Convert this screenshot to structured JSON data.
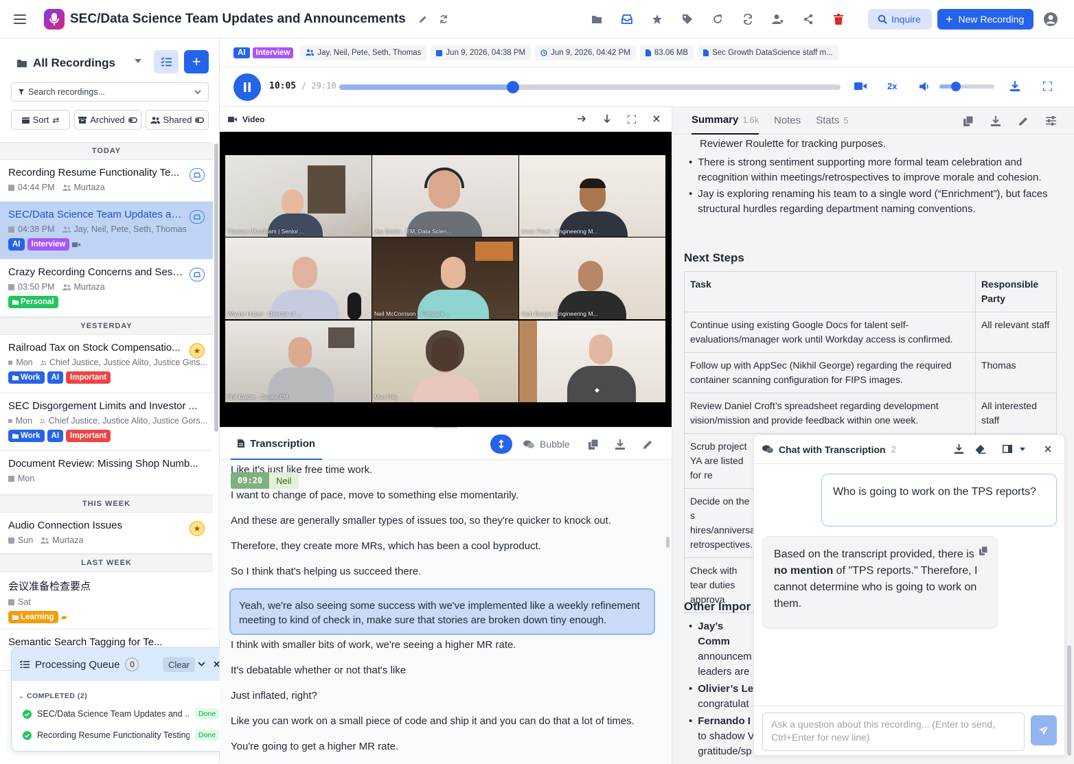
{
  "header": {
    "title": "SEC/Data Science Team Updates and Announcements",
    "inquire_label": "Inquire",
    "new_recording_label": "New Recording"
  },
  "sidebar": {
    "title": "All Recordings",
    "search_placeholder": "Search recordings...",
    "sort_label": "Sort",
    "archived_label": "Archived",
    "shared_label": "Shared",
    "sections": {
      "today": "TODAY",
      "yesterday": "YESTERDAY",
      "this_week": "THIS WEEK",
      "last_week": "LAST WEEK"
    },
    "recordings": [
      {
        "title": "Recording Resume Functionality Te...",
        "time": "04:44 PM",
        "people": "Murtaza"
      },
      {
        "title": "SEC/Data Science Team Updates an...",
        "time": "04:38 PM",
        "people": "Jay, Neil, Pete, Seth, Thomas",
        "tags": [
          "AI",
          "Interview"
        ]
      },
      {
        "title": "Crazy Recording Concerns and Sess...",
        "time": "03:50 PM",
        "people": "Murtaza",
        "tags": [
          "Personal"
        ]
      },
      {
        "title": "Railroad Tax on Stock Compensatio...",
        "time": "Mon",
        "people": "Chief Justice, Justice Alito, Justice Gins...",
        "tags": [
          "Work",
          "AI",
          "Important"
        ]
      },
      {
        "title": "SEC Disgorgement Limits and Investor ...",
        "time": "Mon",
        "people": "Chief Justice, Justice Alito, Justice Gors...",
        "tags": [
          "Work",
          "AI",
          "Important"
        ]
      },
      {
        "title": "Document Review: Missing Shop Numb...",
        "time": "Mon"
      },
      {
        "title": "Audio Connection Issues",
        "time": "Sun",
        "people": "Murtaza"
      },
      {
        "title": "会议准备检查要点",
        "time": "Sat",
        "tags": [
          "Learning"
        ]
      },
      {
        "title": "Semantic Search Tagging for Te..."
      }
    ]
  },
  "queue": {
    "title": "Processing Queue",
    "count": "0",
    "clear_label": "Clear",
    "completed_label": "COMPLETED (2)",
    "items": [
      {
        "name": "SEC/Data Science Team Updates and ...",
        "status": "Done"
      },
      {
        "name": "Recording Resume Functionality Testing",
        "status": "Done"
      }
    ]
  },
  "meta": {
    "ai": "AI",
    "interview": "Interview",
    "participants": "Jay, Neil, Pete, Seth, Thomas",
    "created": "Jun 9, 2026, 04:38 PM",
    "modified": "Jun 9, 2026, 04:42 PM",
    "size": "83.06 MB",
    "file": "Sec Growth DataScience staff m..."
  },
  "player": {
    "current": "10:05",
    "total": "/ 29:10",
    "speed": "2x",
    "progress": 0.347,
    "volume": 0.3
  },
  "video": {
    "label": "Video",
    "tiles": [
      {
        "name": "Thomas Woodham | Senior ..."
      },
      {
        "name": "Jay Swain - EM, Data Scien..."
      },
      {
        "name": "Amar Patel - Engineering M..."
      },
      {
        "name": "Wayne Haber - Director of ..."
      },
      {
        "name": "Neil McCorrison - Fullstack ..."
      },
      {
        "name": "Seth Berger, Engineering M..."
      },
      {
        "name": "Phil Calder - Senior EM"
      },
      {
        "name": "Mon Ray"
      },
      {
        "name": ""
      }
    ]
  },
  "transcription": {
    "tab_label": "Transcription",
    "bubble_label": "Bubble",
    "speaker_time": "09:20",
    "speaker_name": "Neil",
    "lines": [
      "Like it's just like free time work.",
      "I want to change of pace, move to something else momentarily.",
      "And these are generally smaller types of issues too, so they're quicker to knock out.",
      "Therefore, they create more MRs, which has been a cool byproduct.",
      "So I think that's helping us succeed there.",
      "Yeah, we're also seeing some success with we've implemented like a weekly refinement",
      "meeting to kind of check in, make sure that stories are broken down tiny enough.",
      "I think with smaller bits of work, we're seeing a higher MR rate.",
      "It's debatable whether or not that's like",
      "Just inflated, right?",
      "Like you can work on a small piece of code and ship it and you can do that a lot of times.",
      "You're going to get a higher MR rate."
    ]
  },
  "summary": {
    "tabs": [
      {
        "label": "Summary",
        "count": "1.6k"
      },
      {
        "label": "Notes",
        "count": ""
      },
      {
        "label": "Stats",
        "count": "5"
      }
    ],
    "line0": "Reviewer Roulette for tracking purposes.",
    "bullet1a": "There is strong sentiment supporting more formal team celebration and",
    "bullet1b": "recognition within meetings/retrospectives to improve morale and cohesion.",
    "bullet2a": "Jay is exploring renaming his team to a single word (“Enrichment”), but faces",
    "bullet2b": "structural hurdles regarding department naming conventions.",
    "next_steps_heading": "Next Steps",
    "col_task": "Task",
    "col_party": "Responsible Party",
    "rows": [
      {
        "task": "Continue using existing Google Docs for talent self-evaluations/manager work until Workday access is confirmed.",
        "party": "All relevant staff"
      },
      {
        "task": "Follow up with AppSec (Nikhil George) regarding the required container scanning configuration for FIPS images.",
        "party": "Thomas"
      },
      {
        "task": "Review Daniel Croft’s spreadsheet regarding development vision/mission and provide feedback within one week.",
        "party": "All interested staff"
      },
      {
        "task": "Scrub project YA are listed for re",
        "party": ""
      },
      {
        "task": "Decide on the s hires/anniversa retrospectives.",
        "party": ""
      },
      {
        "task": "Check with tear duties approva",
        "party": ""
      }
    ],
    "other_heading": "Other Impor",
    "other1a": "Jay’s Comm",
    "other1b": "announcem",
    "other1c": "leaders are",
    "other2a": "Olivier’s Le",
    "other2b": "congratulat",
    "other3a": "Fernando I",
    "other3b": "to shadow V",
    "other3c": "gratitude/sp"
  },
  "chat": {
    "title": "Chat with Transcription",
    "count": "2",
    "user_message": "Who is going to work on the TPS reports?",
    "reply_part1": "Based on the transcript provided, there is ",
    "reply_bold": "no mention",
    "reply_part2": " of \"TPS reports.\" Therefore, I cannot determine who is going to work on them.",
    "input_placeholder": "Ask a question about this recording... (Enter to send, Ctrl+Enter for new line)"
  },
  "colors": {
    "accent": "#2563eb",
    "ai_tag": "#2563eb",
    "interview_tag": "#a855f7",
    "personal_tag": "#22c55e",
    "work_tag": "#2563eb",
    "important_tag": "#ef4444",
    "learning_tag": "#f59e0b",
    "selected_bg": "#bfd4f5"
  }
}
